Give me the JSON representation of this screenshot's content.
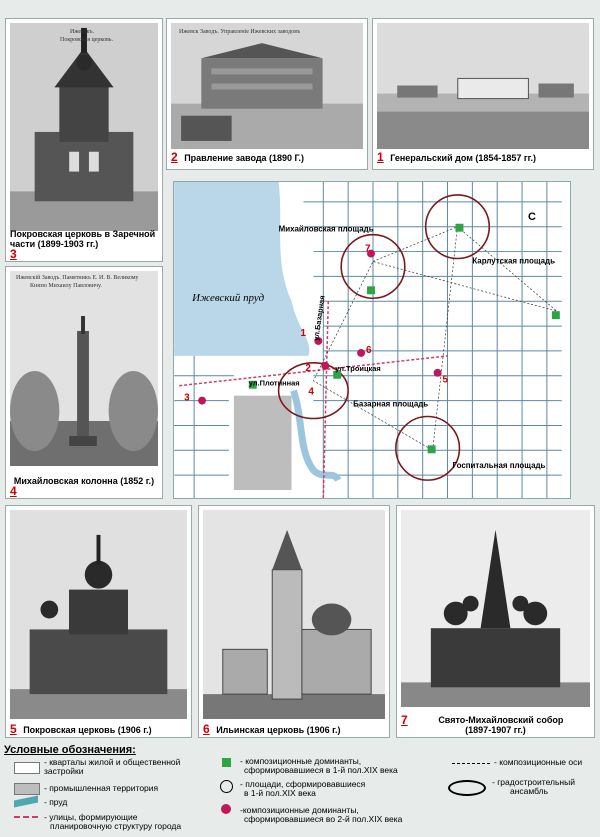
{
  "photos": {
    "p1": {
      "num": "1",
      "caption": "Генеральский дом (1854-1857 гг.)"
    },
    "p2": {
      "num": "2",
      "caption": "Правление завода  (1890 Г.)",
      "inner": "Ижевск Заводъ. Управленiе Ижевских заводовъ"
    },
    "p3": {
      "num": "3",
      "caption": "Покровская церковь в Заречной части (1899-1903 гг.)",
      "inner_line1": "Ижевскъ.",
      "inner_line2": "Покровская церковь."
    },
    "p4": {
      "num": "4",
      "caption": "Михайловская колонна (1852 г.)",
      "inner_line1": "Ижевскiй Заводъ. Памятникъ Е. И. В. Великому",
      "inner_line2": "Князю Михаилу Павловичу."
    },
    "p5": {
      "num": "5",
      "caption": "Покровская церковь (1906 г.)"
    },
    "p6": {
      "num": "6",
      "caption": "Ильинская церковь (1906 г.)"
    },
    "p7": {
      "num": "7",
      "caption_line1": "Свято-Михайловский собор",
      "caption_line2": "(1897-1907 гг.)"
    }
  },
  "map": {
    "pond_label": "Ижевский пруд",
    "mikhailovskaya_square": "Михайловская площадь",
    "karlutskaya_square": "Карлутская площадь",
    "bazarnaya_square": "Базарная площадь",
    "gospitalnaya_square": "Госпитальная площадь",
    "street_bazarnaya": "ул.Базарная",
    "street_plotinnaya": "ул.Плотинная",
    "street_troitskaya": "ул.Троицкая",
    "north_arrow": "С",
    "markers": [
      "1",
      "2",
      "3",
      "4",
      "5",
      "6",
      "7"
    ]
  },
  "legend": {
    "title": "Условные обозначения:",
    "blocks": "- кварталы жилой и общественной застройки",
    "industrial": "- промышленная территория",
    "pond": "- пруд",
    "streets_line1": "- улицы, формирующие",
    "streets_line2": "планировочную структуру города",
    "dominants1_line1": "- композиционные доминанты,",
    "dominants1_line2": "сформировавшиеся в 1-й пол.XIX века",
    "squares_line1": "- площади, сформировавшиеся",
    "squares_line2": "в 1-й пол.XIX века",
    "dominants2_line1": "-композиционные доминанты,",
    "dominants2_line2": "сформировавшиеся во 2-й пол.XIX века",
    "axes": "- композиционные оси",
    "ensemble_line1": "- градостроительный",
    "ensemble_line2": "ансамбль"
  }
}
